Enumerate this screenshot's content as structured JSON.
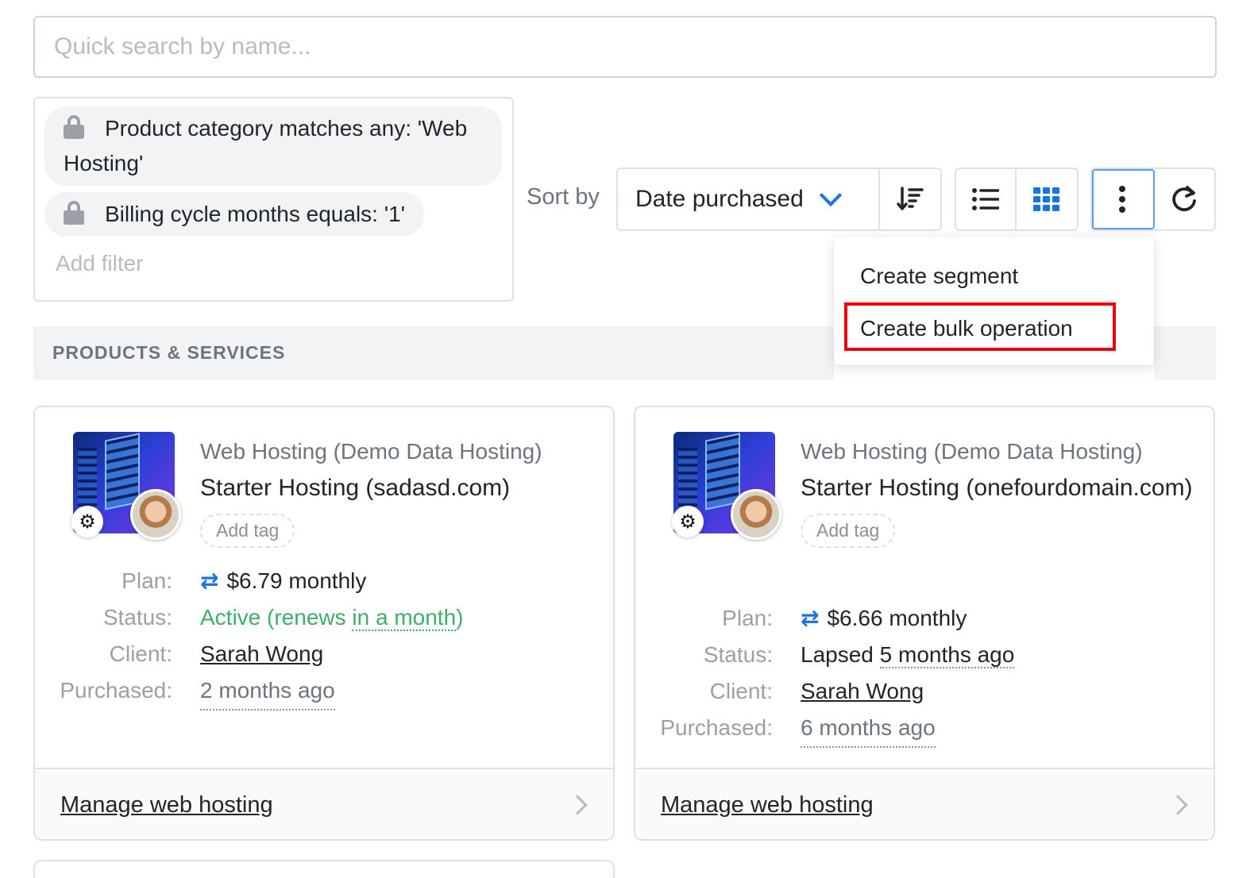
{
  "search": {
    "placeholder": "Quick search by name..."
  },
  "filters": {
    "chips": [
      {
        "text": "Product category matches any: 'Web Hosting'"
      },
      {
        "text": "Billing cycle months equals: '1'"
      }
    ],
    "add_filter": "Add filter"
  },
  "toolbar": {
    "sort_label": "Sort by",
    "sort_value": "Date purchased"
  },
  "menu": {
    "items": [
      "Create segment",
      "Create bulk operation"
    ]
  },
  "section": {
    "title": "PRODUCTS & SERVICES"
  },
  "cards": [
    {
      "category": "Web Hosting (Demo Data Hosting)",
      "title": "Starter Hosting (sadasd.com)",
      "tag": "Add tag",
      "plan_label": "Plan:",
      "plan": "$6.79 monthly",
      "status_label": "Status:",
      "status_prefix": "Active (renews ",
      "status_rel": "in a month",
      "status_suffix": ")",
      "client_label": "Client:",
      "client": "Sarah Wong",
      "purchased_label": "Purchased:",
      "purchased": "2 months ago",
      "footer": "Manage web hosting"
    },
    {
      "category": "Web Hosting (Demo Data Hosting)",
      "title": "Starter Hosting (onefourdomain.com)",
      "tag": "Add tag",
      "plan_label": "Plan:",
      "plan": "$6.66 monthly",
      "status_label": "Status:",
      "status_prefix": "Lapsed ",
      "status_rel": "5 months ago",
      "client_label": "Client:",
      "client": "Sarah Wong",
      "purchased_label": "Purchased:",
      "purchased": "6 months ago",
      "footer": "Manage web hosting"
    }
  ],
  "colors": {
    "accent": "#1a73e8",
    "active": "#3fae68",
    "highlight": "#e8000b"
  },
  "icons": [
    "lock-icon",
    "chevron-down-icon",
    "sort-descending-icon",
    "list-view-icon",
    "grid-view-icon",
    "more-vertical-icon",
    "refresh-icon",
    "swap-icon",
    "gear-icon",
    "chevron-right-icon"
  ]
}
